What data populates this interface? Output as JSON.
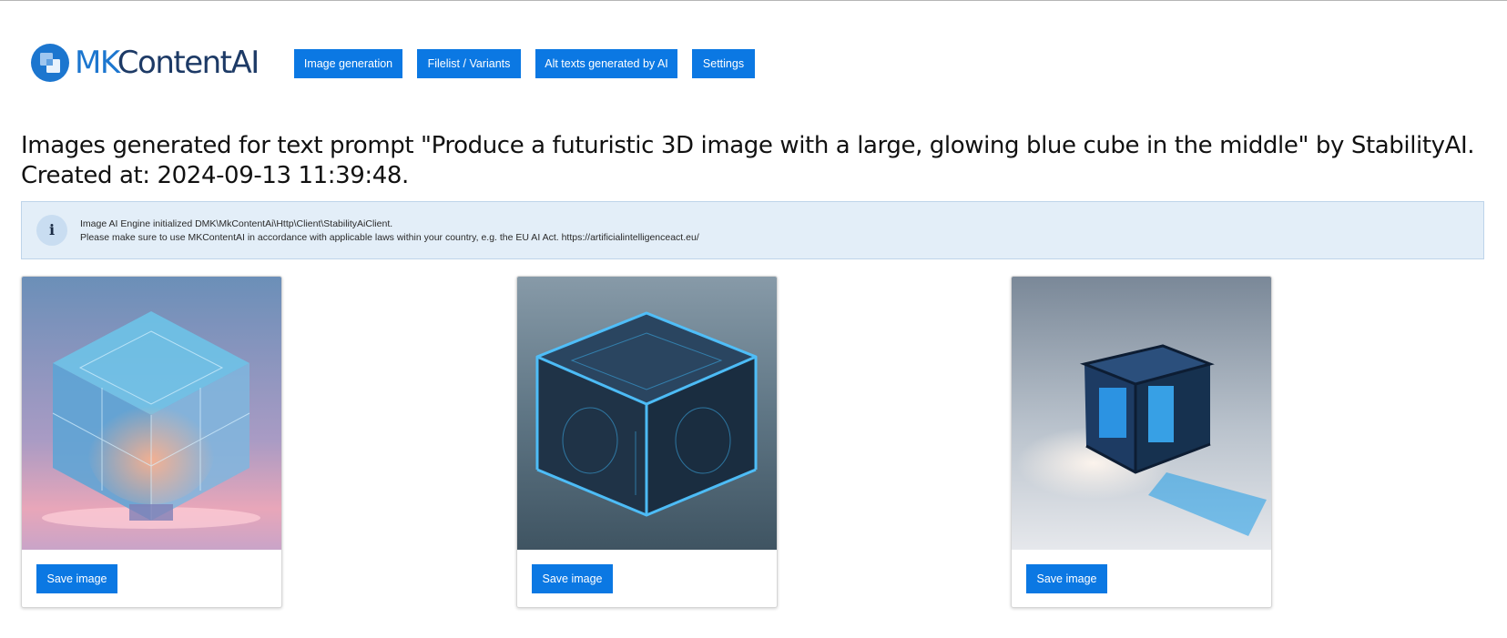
{
  "brand": {
    "name_mk": "MK",
    "name_rest": "ContentAI"
  },
  "nav": [
    {
      "label": "Image generation"
    },
    {
      "label": "Filelist / Variants"
    },
    {
      "label": "Alt texts generated by AI"
    },
    {
      "label": "Settings"
    }
  ],
  "heading": "Images generated for text prompt \"Produce a futuristic 3D image with a large, glowing blue cube in the middle\" by StabilityAI. Created at: 2024-09-13 11:39:48.",
  "info": {
    "icon": "info-icon",
    "icon_glyph": "i",
    "line1": "Image AI Engine initialized DMK\\MkContentAi\\Http\\Client\\StabilityAiClient.",
    "line2": "Please make sure to use MKContentAI in accordance with applicable laws within your country, e.g. the EU AI Act. https://artificialintelligenceact.eu/"
  },
  "images": [
    {
      "save_label": "Save image"
    },
    {
      "save_label": "Save image"
    },
    {
      "save_label": "Save image"
    }
  ],
  "colors": {
    "primary": "#0b78e3",
    "info_bg": "#e3eef8",
    "logo_blue": "#1c76cf",
    "logo_navy": "#1d3a66"
  }
}
